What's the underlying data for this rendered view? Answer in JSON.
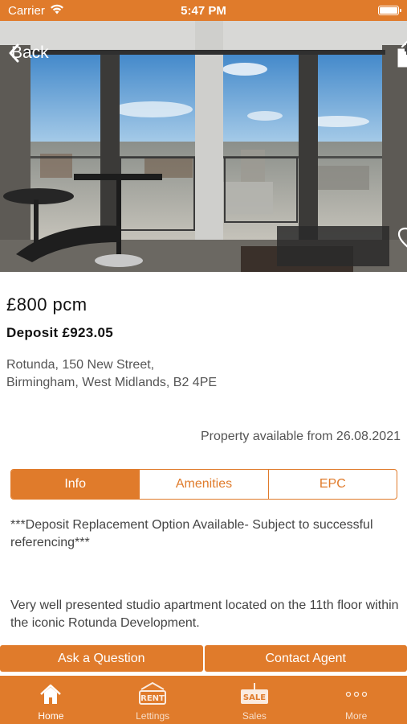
{
  "status_bar": {
    "carrier": "Carrier",
    "time": "5:47 PM"
  },
  "hero": {
    "back_label": "Back",
    "icons": [
      "chevron-left-icon",
      "share-icon",
      "heart-icon"
    ]
  },
  "listing": {
    "price": "£800 pcm",
    "deposit": "Deposit £923.05",
    "address_line1": "Rotunda, 150 New Street,",
    "address_line2": "Birmingham, West Midlands, B2 4PE",
    "available": "Property available from 26.08.2021"
  },
  "tabs": [
    {
      "label": "Info",
      "active": true
    },
    {
      "label": "Amenities",
      "active": false
    },
    {
      "label": "EPC",
      "active": false
    }
  ],
  "info": {
    "paragraph1": "***Deposit Replacement Option Available- Subject to successful referencing***",
    "paragraph2": "Very well presented studio apartment located on the 11th floor within the iconic Rotunda Development."
  },
  "actions": {
    "ask_label": "Ask a Question",
    "contact_label": "Contact Agent"
  },
  "tab_bar": [
    {
      "label": "Home",
      "icon": "home-icon",
      "active": true
    },
    {
      "label": "Lettings",
      "icon": "rent-sign-icon",
      "badge": "RENT",
      "active": false
    },
    {
      "label": "Sales",
      "icon": "sale-sign-icon",
      "badge": "SALE",
      "active": false
    },
    {
      "label": "More",
      "icon": "more-icon",
      "active": false
    }
  ],
  "colors": {
    "accent": "#e07b2b",
    "text_dark": "#111111",
    "text_muted": "#555555"
  }
}
